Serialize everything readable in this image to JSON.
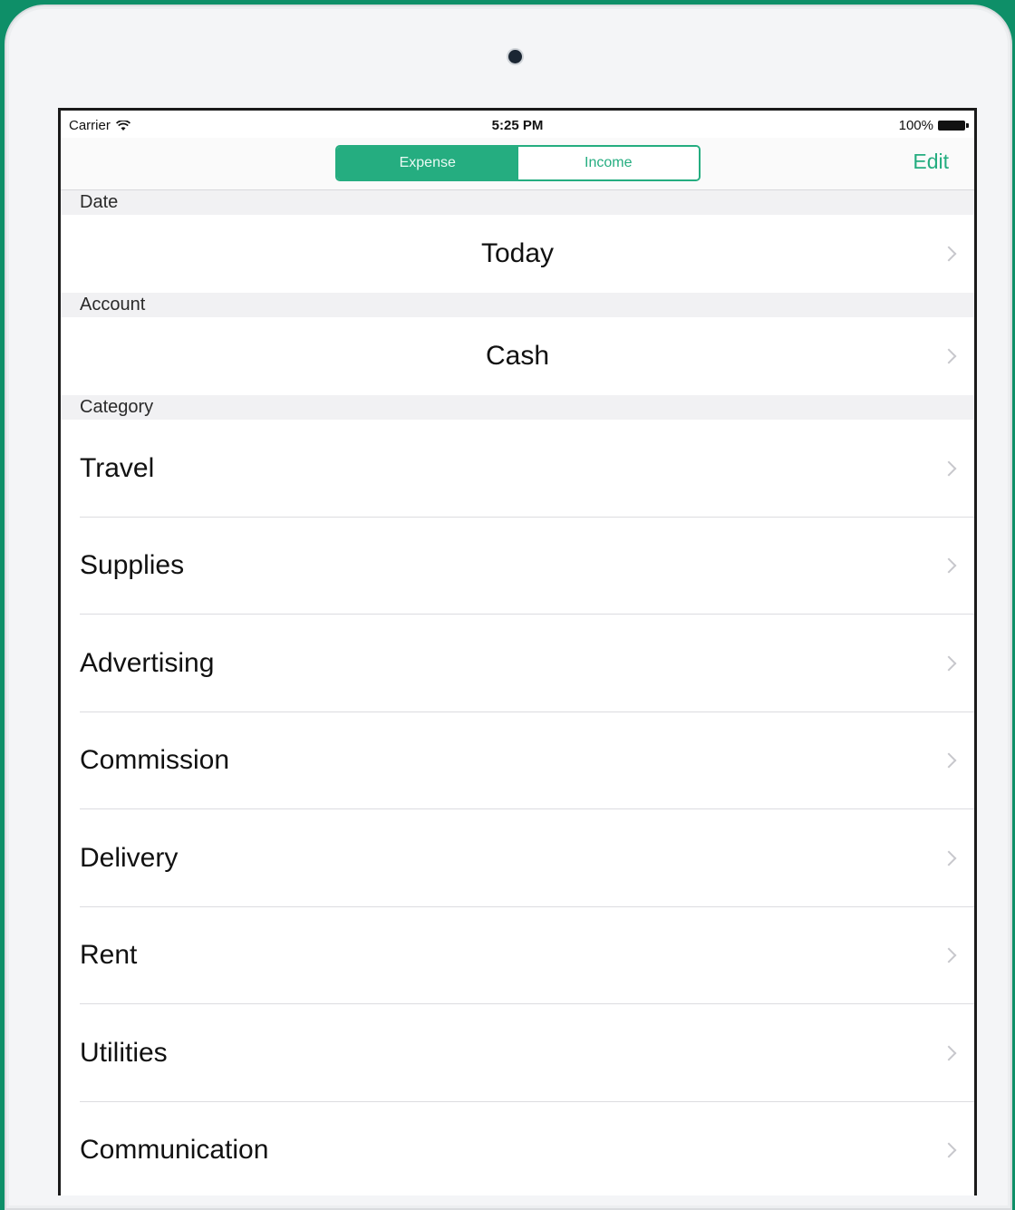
{
  "status_bar": {
    "carrier": "Carrier",
    "time": "5:25 PM",
    "battery": "100%"
  },
  "nav": {
    "segments": [
      "Expense",
      "Income"
    ],
    "active_segment": "Expense",
    "edit_label": "Edit"
  },
  "sections": {
    "date": {
      "header": "Date",
      "value": "Today"
    },
    "account": {
      "header": "Account",
      "value": "Cash"
    },
    "category": {
      "header": "Category",
      "items": [
        "Travel",
        "Supplies",
        "Advertising",
        "Commission",
        "Delivery",
        "Rent",
        "Utilities",
        "Communication"
      ]
    }
  },
  "colors": {
    "accent": "#25ad80",
    "background": "#0e8f68"
  }
}
